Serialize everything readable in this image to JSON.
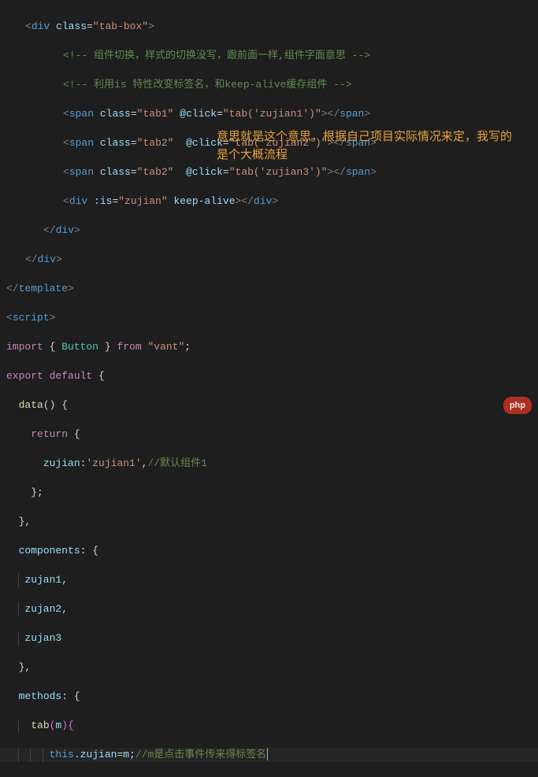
{
  "annotation": "意思就是这个意思，根据自己项目实际情况来定，我写的是个大概流程",
  "logo": "php",
  "code": {
    "l1": {
      "open": "<",
      "tag": "div",
      "attr": "class",
      "eq": "=",
      "val": "\"tab-box\"",
      "close": ">"
    },
    "l2": {
      "open": "<!--",
      "text": " 组件切换，样式的切换没写，跟前面一样,组件字面意思 ",
      "close": "-->"
    },
    "l3": {
      "open": "<!--",
      "text": " 利用is 特性改变标签名，和keep-alive缓存组件 ",
      "close": "-->"
    },
    "l4": {
      "open": "<",
      "tag": "span",
      "a1": "class",
      "v1": "\"tab1\"",
      "a2": "@click",
      "v2": "\"tab('zujian1')\"",
      "mid": "></",
      "close": ">"
    },
    "l5": {
      "open": "<",
      "tag": "span",
      "a1": "class",
      "v1": "\"tab2\"",
      "sp": "  ",
      "a2": "@click",
      "v2": "\"tab('zujian2')\"",
      "mid": "></",
      "close": ">"
    },
    "l6": {
      "open": "<",
      "tag": "span",
      "a1": "class",
      "v1": "\"tab2\"",
      "sp": "  ",
      "a2": "@click",
      "v2": "\"tab('zujian3')\"",
      "mid": "></",
      "close": ">"
    },
    "l7": {
      "open": "<",
      "tag": "div",
      "a1": ":is",
      "v1": "\"zujian\"",
      "a2": "keep-alive",
      "mid": "></",
      "close": ">"
    },
    "l8": {
      "open": "</",
      "tag": "div",
      "close": ">"
    },
    "l9": {
      "open": "</",
      "tag": "div",
      "close": ">"
    },
    "l10": {
      "open": "</",
      "tag": "template",
      "close": ">"
    },
    "l11": {
      "open": "<",
      "tag": "script",
      "close": ">"
    },
    "l12": {
      "kw": "import",
      "br1": " { ",
      "cls": "Button",
      "br2": " } ",
      "from": "from",
      "sp": " ",
      "str": "\"vant\"",
      "end": ";"
    },
    "l13": {
      "kw1": "export",
      "kw2": "default",
      "br": " {"
    },
    "l14": {
      "fn": "data",
      "p": "() {"
    },
    "l15": {
      "kw": "return",
      "br": " {"
    },
    "l16": {
      "key": "zujian",
      "col": ":",
      "val": "'zujian1'",
      "end": ",",
      "cm": "//默认组件1"
    },
    "l17": {
      "br": "};"
    },
    "l18": {
      "br": "},"
    },
    "l19": {
      "key": "components",
      "col": ":",
      "br": " {"
    },
    "l20": {
      "v": "zujan1",
      "end": ","
    },
    "l21": {
      "v": "zujan2",
      "end": ","
    },
    "l22": {
      "v": "zujan3"
    },
    "l23": {
      "br": "},"
    },
    "l24": {
      "key": "methods",
      "col": ":",
      "br": " {"
    },
    "l25": {
      "fn": "tab",
      "p1": "(",
      "arg": "m",
      "p2": "){"
    },
    "l26": {
      "th": "this",
      "dot": ".",
      "prop": "zujian",
      "eq": "=",
      "v": "m",
      "end": ";",
      "cm": "//m是点击事件传来得标签名"
    }
  }
}
